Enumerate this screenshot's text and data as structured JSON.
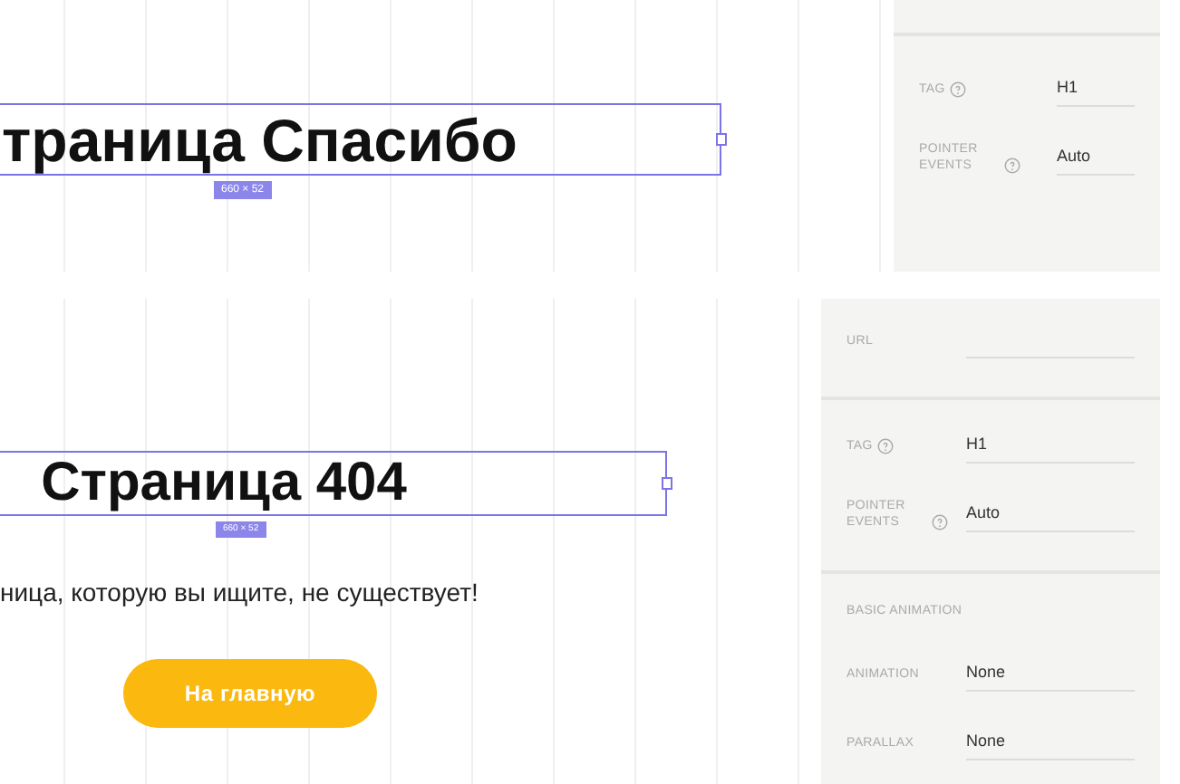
{
  "screens": [
    {
      "heading": "траница Спасибо",
      "size_badge": "660 × 52",
      "panel": [
        {
          "kind": "divider"
        },
        {
          "kind": "field",
          "label": "TAG",
          "help": true,
          "value": "H1"
        },
        {
          "kind": "field",
          "label": "POINTER EVENTS",
          "help": true,
          "value": "Auto"
        }
      ]
    },
    {
      "heading": "Страница 404",
      "size_badge": "660 × 52",
      "text": "ница, которую вы ищите, не существует!",
      "button": "На главную",
      "panel": [
        {
          "kind": "field",
          "label": "URL",
          "help": false
        },
        {
          "kind": "divider"
        },
        {
          "kind": "field",
          "label": "TAG",
          "help": true,
          "value": "H1"
        },
        {
          "kind": "field",
          "label": "POINTER EVENTS",
          "help": true,
          "value": "Auto"
        },
        {
          "kind": "divider"
        },
        {
          "kind": "section",
          "label": "BASIC ANIMATION"
        },
        {
          "kind": "field",
          "label": "ANIMATION",
          "help": false,
          "value": "None"
        },
        {
          "kind": "field",
          "label": "PARALLAX",
          "help": false,
          "value": "None"
        }
      ]
    }
  ]
}
